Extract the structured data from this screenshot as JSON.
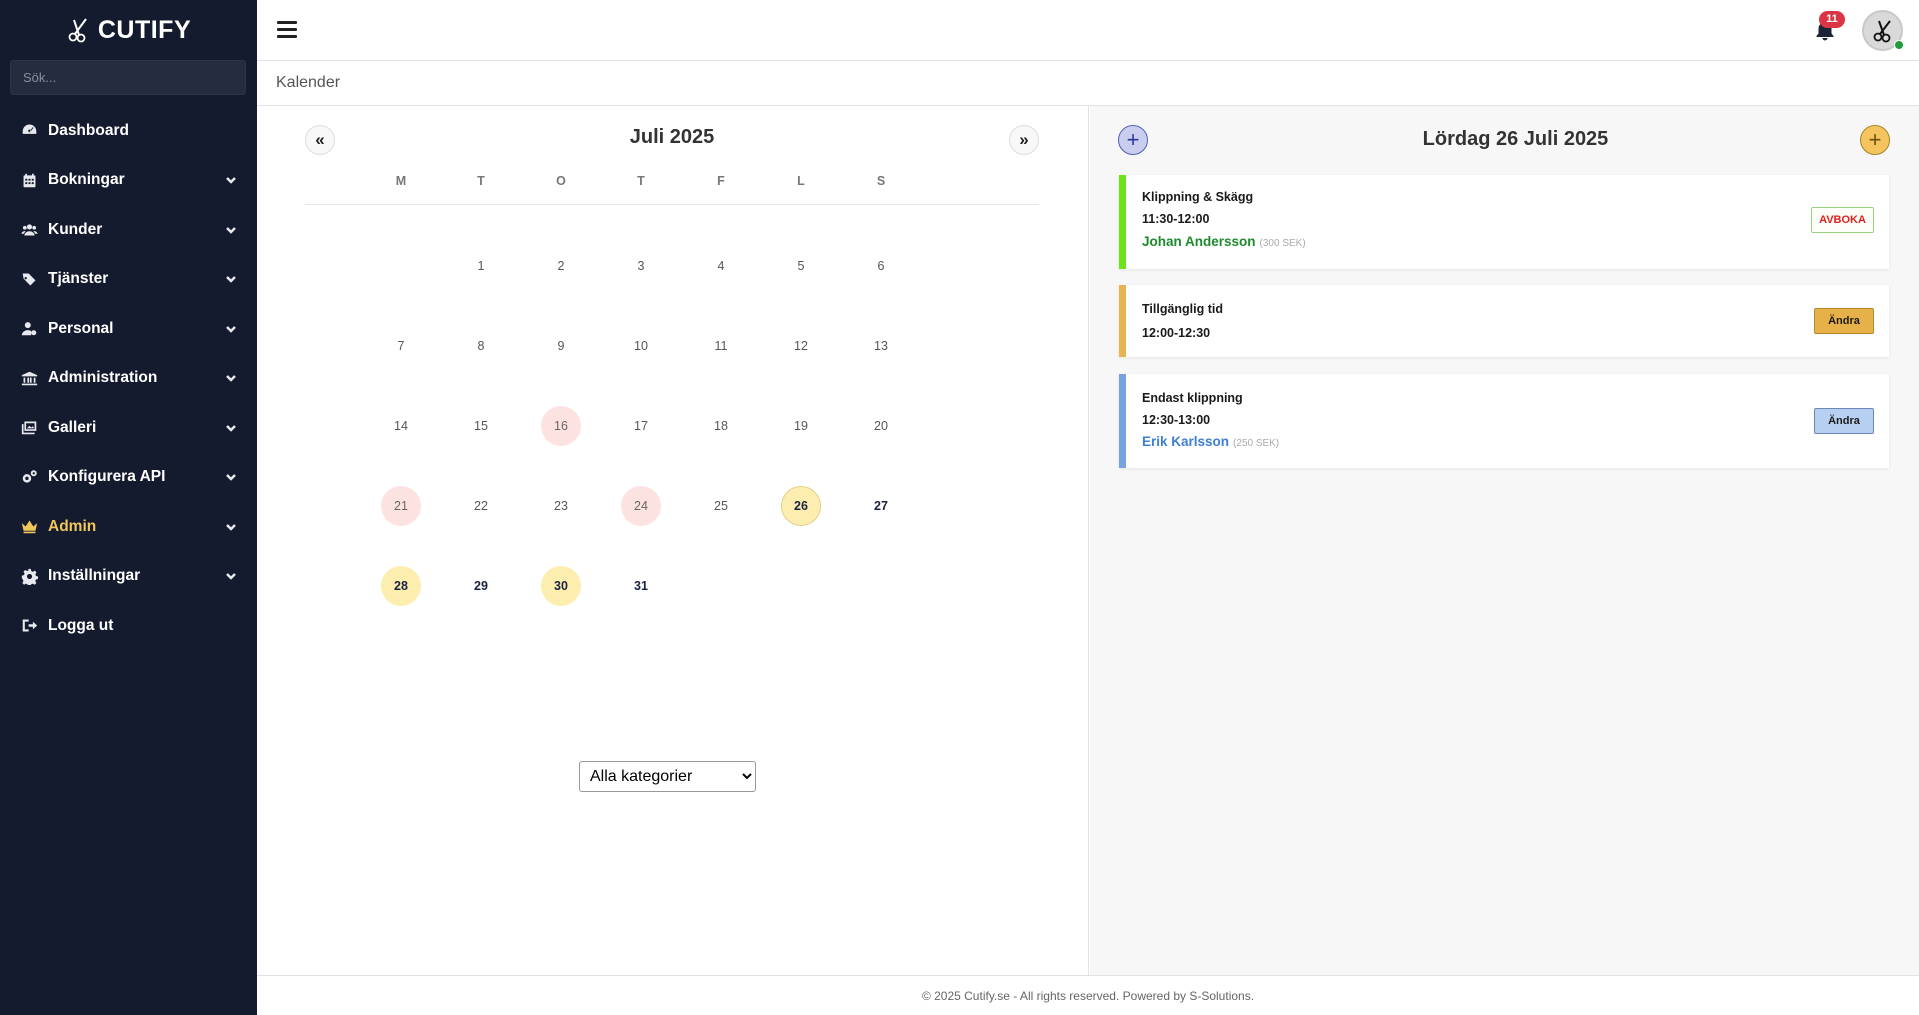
{
  "brand": {
    "name": "CUTIFY",
    "icon": "scissors-icon"
  },
  "search": {
    "placeholder": "Sök..."
  },
  "sidebar": {
    "items": [
      {
        "label": "Dashboard",
        "icon": "dashboard-icon",
        "has_submenu": false
      },
      {
        "label": "Bokningar",
        "icon": "calendar-icon",
        "has_submenu": true
      },
      {
        "label": "Kunder",
        "icon": "users-icon",
        "has_submenu": true
      },
      {
        "label": "Tjänster",
        "icon": "tags-icon",
        "has_submenu": true
      },
      {
        "label": "Personal",
        "icon": "user-gear-icon",
        "has_submenu": true
      },
      {
        "label": "Administration",
        "icon": "building-icon",
        "has_submenu": true
      },
      {
        "label": "Galleri",
        "icon": "images-icon",
        "has_submenu": true
      },
      {
        "label": "Konfigurera API",
        "icon": "gears-icon",
        "has_submenu": true
      },
      {
        "label": "Admin",
        "icon": "crown-icon",
        "has_submenu": true,
        "accent": "#f1c75c"
      },
      {
        "label": "Inställningar",
        "icon": "gear-icon",
        "has_submenu": true
      },
      {
        "label": "Logga ut",
        "icon": "logout-icon",
        "has_submenu": false
      }
    ]
  },
  "topbar": {
    "notification_count": "11"
  },
  "breadcrumb": {
    "title": "Kalender"
  },
  "calendar": {
    "prev_label": "«",
    "next_label": "»",
    "month_title": "Juli 2025",
    "weekdays": [
      "M",
      "T",
      "O",
      "T",
      "F",
      "L",
      "S"
    ],
    "weeks": [
      [
        null,
        "1",
        "2",
        "3",
        "4",
        "5",
        "6"
      ],
      [
        "7",
        "8",
        "9",
        "10",
        "11",
        "12",
        "13"
      ],
      [
        "14",
        "15",
        "16",
        "17",
        "18",
        "19",
        "20"
      ],
      [
        "21",
        "22",
        "23",
        "24",
        "25",
        "26",
        "27"
      ],
      [
        "28",
        "29",
        "30",
        "31",
        null,
        null,
        null
      ]
    ],
    "pink_days": [
      "16",
      "21",
      "24"
    ],
    "yellow_days": [
      "26",
      "28",
      "30"
    ],
    "bold_days": [
      "27",
      "29",
      "31"
    ],
    "selected_day": "26",
    "category_filter": {
      "selected": "Alla kategorier",
      "options": [
        "Alla kategorier"
      ]
    }
  },
  "day_panel": {
    "title": "Lördag 26 Juli 2025",
    "bookings": [
      {
        "title": "Klippning & Skägg",
        "time": "11:30-12:00",
        "customer": "Johan Andersson",
        "price": "(300 SEK)",
        "action": "AVBOKA",
        "color": "#6ee31a"
      },
      {
        "title": "Tillgänglig tid",
        "time": "12:00-12:30",
        "customer": "",
        "price": "",
        "action": "Ändra",
        "color": "#e7b451"
      },
      {
        "title": "Endast klippning",
        "time": "12:30-13:00",
        "customer": "Erik Karlsson",
        "price": "(250 SEK)",
        "action": "Ändra",
        "color": "#74a3e0"
      }
    ]
  },
  "footer": {
    "text": "© 2025 Cutify.se - All rights reserved. Powered by S-Solutions."
  }
}
